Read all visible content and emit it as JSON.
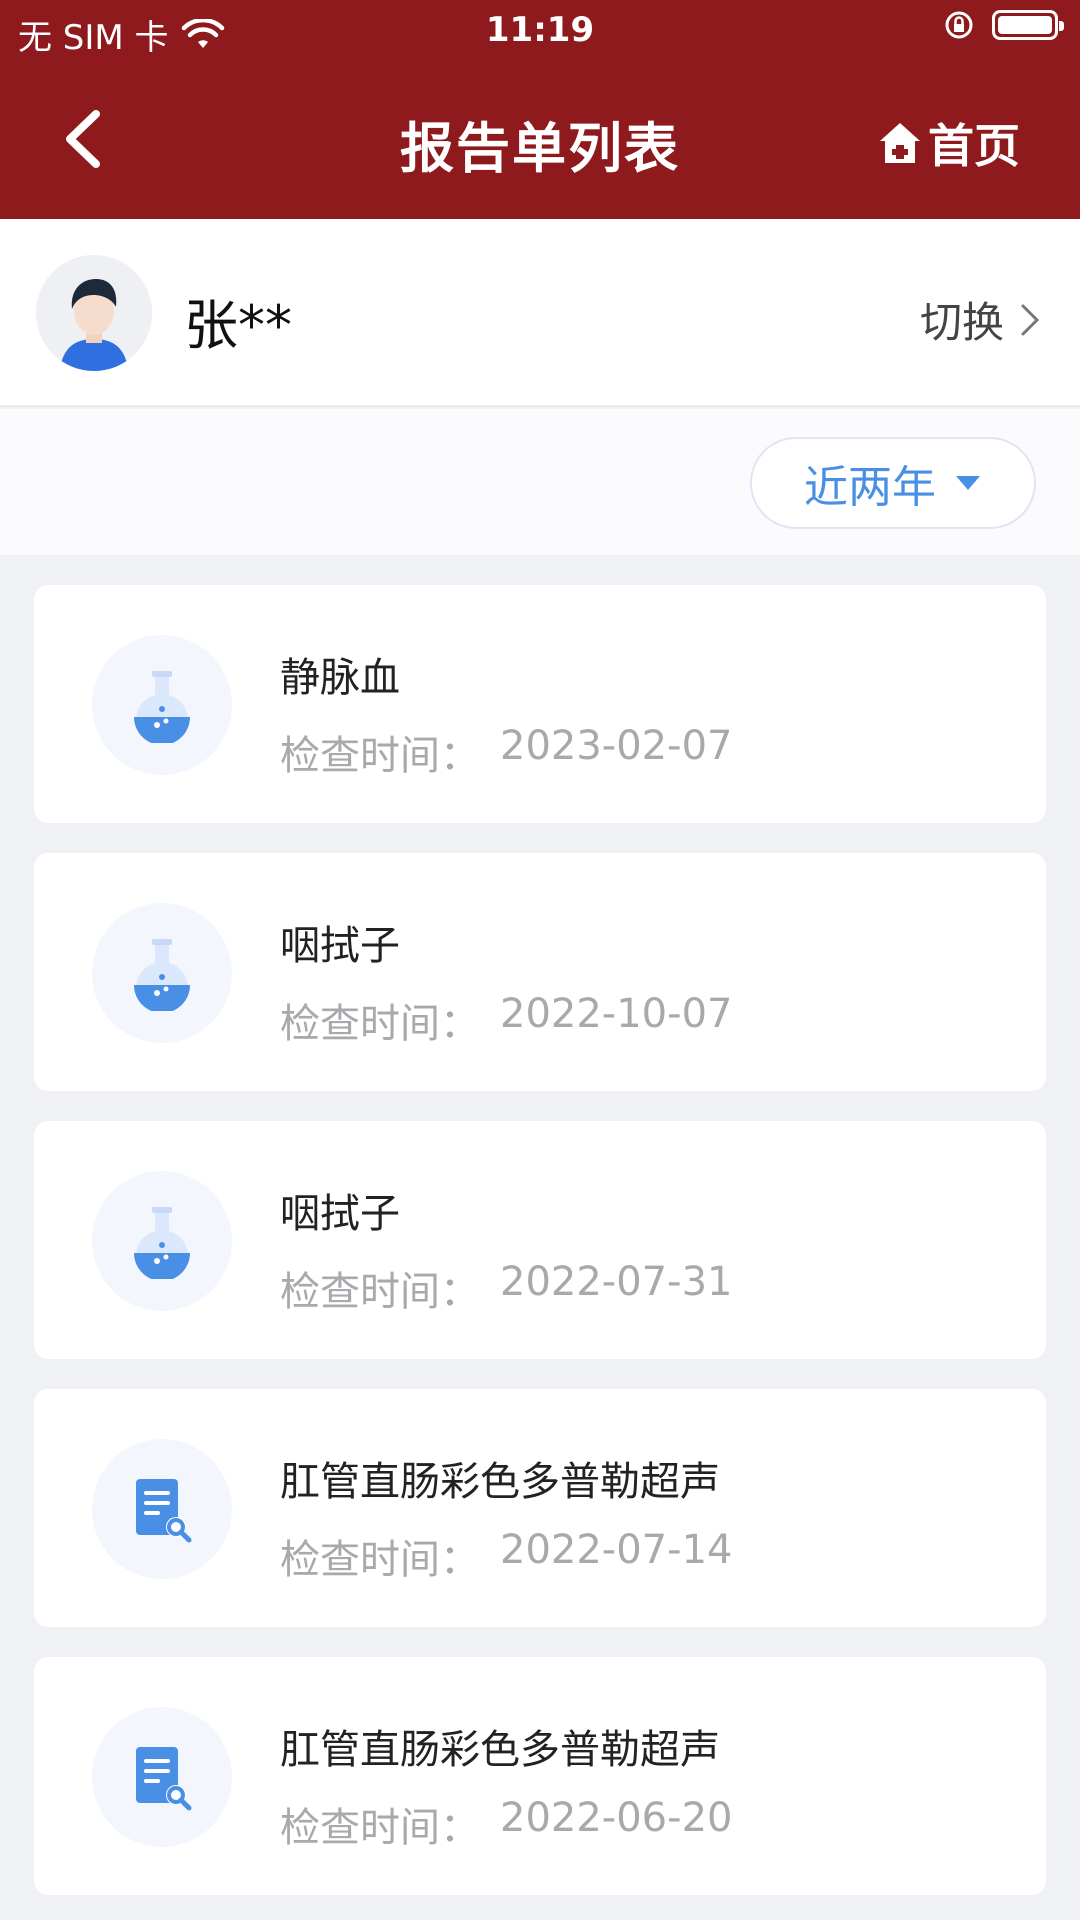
{
  "status_bar": {
    "carrier": "无 SIM 卡",
    "time": "11:19"
  },
  "nav": {
    "title": "报告单列表",
    "home_label": "首页"
  },
  "user": {
    "name": "张**",
    "switch_label": "切换"
  },
  "filter": {
    "label": "近两年"
  },
  "colors": {
    "header": "#8e1a1d",
    "accent": "#4a8fe6"
  },
  "reports": [
    {
      "icon": "flask-icon",
      "name": "静脉血",
      "time_label": "检查时间：",
      "date": "2023-02-07"
    },
    {
      "icon": "flask-icon",
      "name": "咽拭子",
      "time_label": "检查时间：",
      "date": "2022-10-07"
    },
    {
      "icon": "flask-icon",
      "name": "咽拭子",
      "time_label": "检查时间：",
      "date": "2022-07-31"
    },
    {
      "icon": "document-search-icon",
      "name": "肛管直肠彩色多普勒超声",
      "time_label": "检查时间：",
      "date": "2022-07-14"
    },
    {
      "icon": "document-search-icon",
      "name": "肛管直肠彩色多普勒超声",
      "time_label": "检查时间：",
      "date": "2022-06-20"
    }
  ]
}
